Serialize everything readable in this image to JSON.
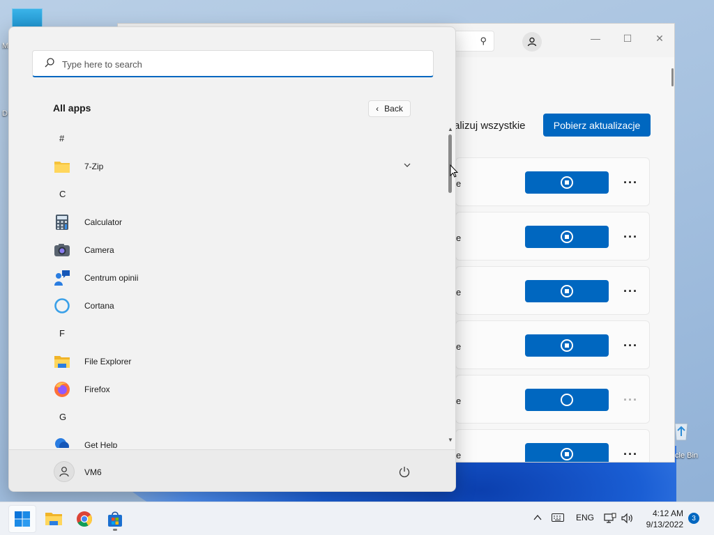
{
  "desktop": {
    "top_icon_label": "M",
    "side_label": "D",
    "recycle_label": "cle Bin"
  },
  "store_window": {
    "update_all_label": "alizuj wszystkie",
    "get_updates_label": "Pobierz aktualizacje",
    "rows": [
      {
        "fragment": "e",
        "state": "stop"
      },
      {
        "fragment": "e",
        "state": "stop"
      },
      {
        "fragment": "e",
        "state": "stop"
      },
      {
        "fragment": "e",
        "state": "stop"
      },
      {
        "fragment": "e",
        "state": "loading"
      },
      {
        "fragment": "e",
        "state": "stop"
      }
    ]
  },
  "start_menu": {
    "search_placeholder": "Type here to search",
    "all_apps_label": "All apps",
    "back_label": "Back",
    "apps": [
      {
        "type": "letter",
        "text": "#"
      },
      {
        "type": "app",
        "name": "7-Zip",
        "icon": "folder-icon",
        "expandable": true
      },
      {
        "type": "letter",
        "text": "C"
      },
      {
        "type": "app",
        "name": "Calculator",
        "icon": "calculator-icon"
      },
      {
        "type": "app",
        "name": "Camera",
        "icon": "camera-icon"
      },
      {
        "type": "app",
        "name": "Centrum opinii",
        "icon": "feedback-hub-icon"
      },
      {
        "type": "app",
        "name": "Cortana",
        "icon": "cortana-icon"
      },
      {
        "type": "letter",
        "text": "F"
      },
      {
        "type": "app",
        "name": "File Explorer",
        "icon": "file-explorer-icon"
      },
      {
        "type": "app",
        "name": "Firefox",
        "icon": "firefox-icon"
      },
      {
        "type": "letter",
        "text": "G"
      },
      {
        "type": "app",
        "name": "Get Help",
        "icon": "get-help-icon"
      }
    ],
    "user_name": "VM6"
  },
  "taskbar": {
    "apps": [
      "start-icon",
      "file-explorer-icon",
      "chrome-icon",
      "store-icon"
    ],
    "language": "ENG",
    "time": "4:12 AM",
    "date": "9/13/2022",
    "notification_count": "3"
  }
}
